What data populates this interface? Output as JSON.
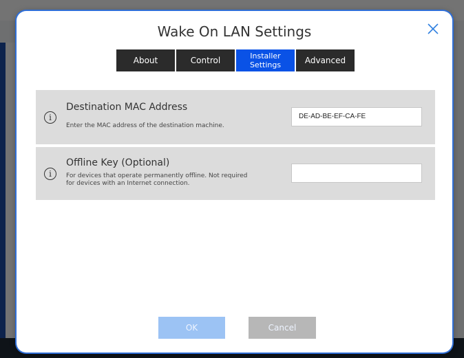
{
  "dialog": {
    "title": "Wake On LAN Settings",
    "tabs": [
      {
        "label": "About"
      },
      {
        "label": "Control"
      },
      {
        "label": "Installer Settings",
        "active": true
      },
      {
        "label": "Advanced"
      }
    ],
    "rows": [
      {
        "title": "Destination MAC Address",
        "description": "Enter the MAC address of the destination machine.",
        "value": "DE-AD-BE-EF-CA-FE",
        "icon": "info-icon"
      },
      {
        "title": "Offline Key (Optional)",
        "description": "For devices that operate permanently offline. Not required for devices with an Internet connection.",
        "value": "",
        "icon": "info-icon"
      }
    ],
    "buttons": {
      "ok": "OK",
      "cancel": "Cancel"
    }
  },
  "colors": {
    "active_tab": "#0a52e6",
    "tab": "#2b2b2b",
    "ok_button": "#9cc3f4",
    "cancel_button": "#b7b7b7",
    "row_background": "#dcdcdc"
  }
}
